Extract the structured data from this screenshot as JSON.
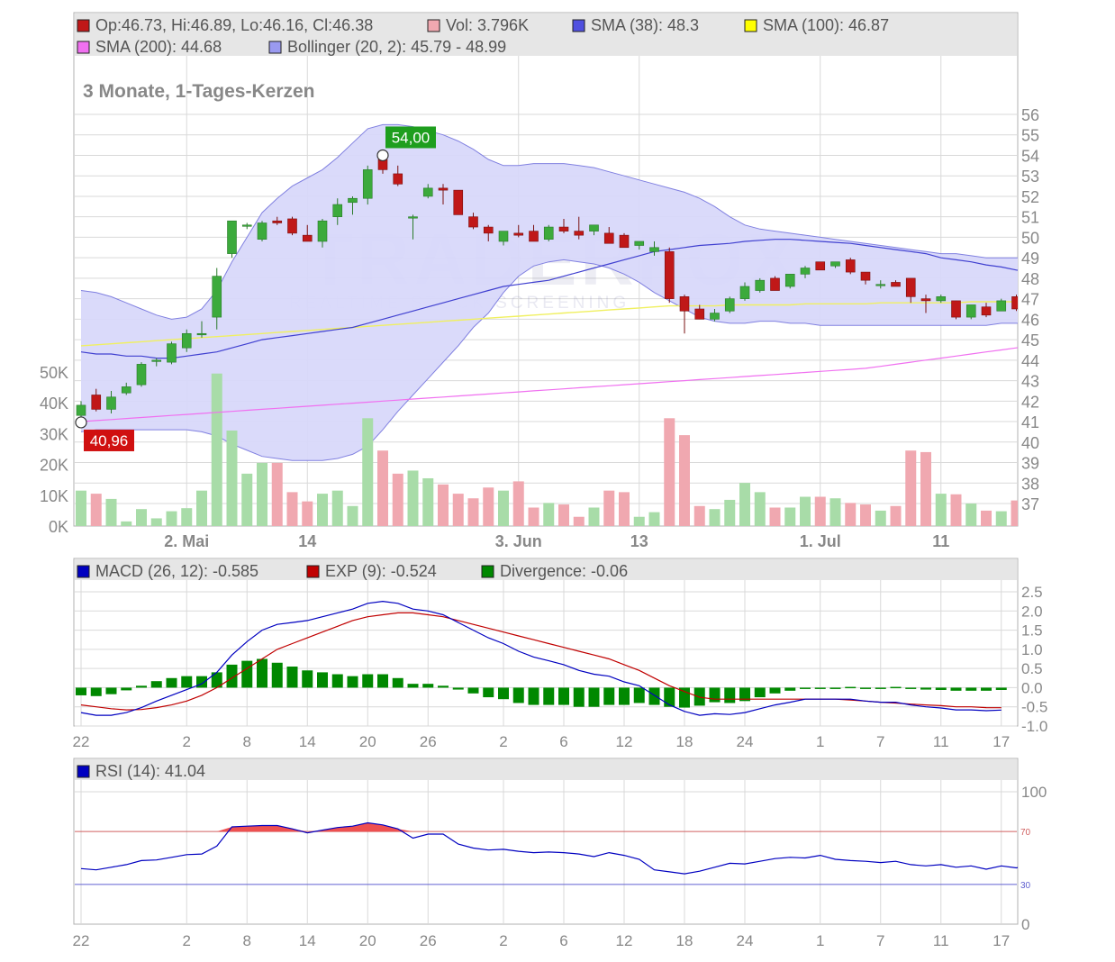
{
  "colors": {
    "up": "#3caa3c",
    "down": "#c01818",
    "up_vol": "#a8dca8",
    "down_vol": "#f0a8b0",
    "band": "#d8d8fa",
    "band_line": "#8080e0",
    "sma38": "#4040d0",
    "sma100": "#f0f060",
    "sma200": "#f070f0",
    "macd": "#0000c0",
    "signal": "#c00000",
    "hist": "#008800",
    "rsi": "#0000c0",
    "grid": "#d9d9d9",
    "legend_bg": "#e6e6e6",
    "axis_text": "#888888"
  },
  "price_panel": {
    "legend_row1": [
      {
        "swatch": "#c01818",
        "text": "Op:46.73, Hi:46.89, Lo:46.16, Cl:46.38"
      },
      {
        "swatch": "#f0a8b0",
        "text": "Vol: 3.796K"
      },
      {
        "swatch": "#5050e0",
        "text": "SMA (38): 48.3"
      },
      {
        "swatch": "#ffff00",
        "text": "SMA (100): 46.87"
      }
    ],
    "legend_row2": [
      {
        "swatch": "#f070f0",
        "text": "SMA (200): 44.68"
      },
      {
        "swatch": "#9a9af0",
        "text": "Bollinger (20, 2): 45.79 - 48.99"
      }
    ],
    "subtitle": "3 Monate, 1-Tages-Kerzen",
    "watermark": "TRADERFOX",
    "watermark_sub": "REALTIME STOCK SCREENING",
    "high_label": "54,00",
    "low_label": "40,96",
    "x_labels": [
      {
        "i": 7,
        "t": "2. Mai"
      },
      {
        "i": 15,
        "t": "14"
      },
      {
        "i": 29,
        "t": "3. Jun"
      },
      {
        "i": 37,
        "t": "13"
      },
      {
        "i": 49,
        "t": "1. Jul"
      },
      {
        "i": 57,
        "t": "11"
      }
    ],
    "y_labels": [
      "56",
      "55",
      "54",
      "53",
      "52",
      "51",
      "50",
      "49",
      "48",
      "47",
      "46",
      "45",
      "44",
      "43",
      "42",
      "41",
      "40",
      "39",
      "38",
      "37"
    ],
    "vol_labels": [
      "50K",
      "40K",
      "30K",
      "20K",
      "10K",
      "0K"
    ]
  },
  "macd_panel": {
    "legend": [
      {
        "swatch": "#0000c0",
        "text": "MACD (26, 12): -0.585"
      },
      {
        "swatch": "#c00000",
        "text": "EXP (9): -0.524"
      },
      {
        "swatch": "#008800",
        "text": "Divergence: -0.06"
      }
    ],
    "y_labels": [
      "2.5",
      "2.0",
      "1.5",
      "1.0",
      "0.5",
      "0.0",
      "-0.5",
      "-1.0"
    ]
  },
  "rsi_panel": {
    "legend": [
      {
        "swatch": "#0000c0",
        "text": "RSI (14): 41.04"
      }
    ],
    "y_labels": [
      "100",
      "0"
    ],
    "level_high": "70",
    "level_low": "30"
  },
  "bottom_x_labels": [
    {
      "i": 0,
      "t": "22"
    },
    {
      "i": 7,
      "t": "2"
    },
    {
      "i": 11,
      "t": "8"
    },
    {
      "i": 15,
      "t": "14"
    },
    {
      "i": 19,
      "t": "20"
    },
    {
      "i": 23,
      "t": "26"
    },
    {
      "i": 28,
      "t": "2"
    },
    {
      "i": 32,
      "t": "6"
    },
    {
      "i": 36,
      "t": "12"
    },
    {
      "i": 40,
      "t": "18"
    },
    {
      "i": 44,
      "t": "24"
    },
    {
      "i": 49,
      "t": "1"
    },
    {
      "i": 53,
      "t": "7"
    },
    {
      "i": 57,
      "t": "11"
    },
    {
      "i": 61,
      "t": "17"
    }
  ],
  "chart_data": {
    "type": "candlestick",
    "title": "3 Monate, 1-Tages-Kerzen",
    "price_range": [
      37,
      56
    ],
    "volume_range": [
      0,
      50000
    ],
    "candles": [
      {
        "o": 41.3,
        "h": 42.0,
        "l": 40.96,
        "c": 41.8,
        "v": 11500
      },
      {
        "o": 42.3,
        "h": 42.6,
        "l": 41.5,
        "c": 41.6,
        "v": 10500
      },
      {
        "o": 41.6,
        "h": 42.5,
        "l": 41.4,
        "c": 42.2,
        "v": 8800
      },
      {
        "o": 42.4,
        "h": 42.9,
        "l": 42.3,
        "c": 42.7,
        "v": 1500
      },
      {
        "o": 42.8,
        "h": 43.9,
        "l": 42.7,
        "c": 43.8,
        "v": 5500
      },
      {
        "o": 44.0,
        "h": 44.1,
        "l": 43.7,
        "c": 44.0,
        "v": 2500
      },
      {
        "o": 43.9,
        "h": 44.9,
        "l": 43.8,
        "c": 44.8,
        "v": 4800
      },
      {
        "o": 44.6,
        "h": 45.5,
        "l": 44.4,
        "c": 45.3,
        "v": 5800
      },
      {
        "o": 45.3,
        "h": 45.9,
        "l": 45.1,
        "c": 45.3,
        "v": 11500
      },
      {
        "o": 46.1,
        "h": 48.5,
        "l": 45.5,
        "c": 48.1,
        "v": 49500
      },
      {
        "o": 49.2,
        "h": 50.8,
        "l": 49.0,
        "c": 50.8,
        "v": 31000
      },
      {
        "o": 50.6,
        "h": 50.7,
        "l": 50.4,
        "c": 50.6,
        "v": 17000
      },
      {
        "o": 49.9,
        "h": 50.8,
        "l": 49.8,
        "c": 50.7,
        "v": 20500
      },
      {
        "o": 50.8,
        "h": 51.0,
        "l": 50.6,
        "c": 50.7,
        "v": 20500
      },
      {
        "o": 50.9,
        "h": 51.0,
        "l": 50.1,
        "c": 50.2,
        "v": 11000
      },
      {
        "o": 50.1,
        "h": 50.6,
        "l": 49.8,
        "c": 49.8,
        "v": 8000
      },
      {
        "o": 49.8,
        "h": 50.9,
        "l": 49.5,
        "c": 50.8,
        "v": 10500
      },
      {
        "o": 51.0,
        "h": 51.9,
        "l": 50.6,
        "c": 51.6,
        "v": 11500
      },
      {
        "o": 51.7,
        "h": 52.0,
        "l": 51.1,
        "c": 51.9,
        "v": 6500
      },
      {
        "o": 51.9,
        "h": 53.5,
        "l": 51.6,
        "c": 53.3,
        "v": 35000
      },
      {
        "o": 53.8,
        "h": 54.0,
        "l": 53.1,
        "c": 53.3,
        "v": 24500
      },
      {
        "o": 53.1,
        "h": 53.5,
        "l": 52.5,
        "c": 52.6,
        "v": 17000
      },
      {
        "o": 51.0,
        "h": 51.1,
        "l": 49.9,
        "c": 51.0,
        "v": 18000
      },
      {
        "o": 52.0,
        "h": 52.6,
        "l": 51.9,
        "c": 52.4,
        "v": 15500
      },
      {
        "o": 52.4,
        "h": 52.6,
        "l": 51.6,
        "c": 52.3,
        "v": 13500
      },
      {
        "o": 52.3,
        "h": 52.3,
        "l": 51.1,
        "c": 51.1,
        "v": 10500
      },
      {
        "o": 51.0,
        "h": 51.2,
        "l": 50.4,
        "c": 50.5,
        "v": 9000
      },
      {
        "o": 50.5,
        "h": 50.6,
        "l": 49.8,
        "c": 50.2,
        "v": 12500
      },
      {
        "o": 49.8,
        "h": 50.3,
        "l": 49.6,
        "c": 50.3,
        "v": 11500
      },
      {
        "o": 50.2,
        "h": 50.6,
        "l": 50.0,
        "c": 50.1,
        "v": 14500
      },
      {
        "o": 50.3,
        "h": 50.6,
        "l": 49.8,
        "c": 49.8,
        "v": 6000
      },
      {
        "o": 49.9,
        "h": 50.6,
        "l": 49.8,
        "c": 50.5,
        "v": 7500
      },
      {
        "o": 50.5,
        "h": 50.9,
        "l": 50.2,
        "c": 50.3,
        "v": 7000
      },
      {
        "o": 50.3,
        "h": 51.0,
        "l": 49.9,
        "c": 50.1,
        "v": 3000
      },
      {
        "o": 50.3,
        "h": 50.6,
        "l": 50.1,
        "c": 50.6,
        "v": 6000
      },
      {
        "o": 50.2,
        "h": 50.5,
        "l": 49.7,
        "c": 49.7,
        "v": 11500
      },
      {
        "o": 50.1,
        "h": 50.2,
        "l": 49.5,
        "c": 49.5,
        "v": 11000
      },
      {
        "o": 49.6,
        "h": 49.8,
        "l": 49.4,
        "c": 49.8,
        "v": 3000
      },
      {
        "o": 49.3,
        "h": 49.8,
        "l": 49.1,
        "c": 49.5,
        "v": 4500
      },
      {
        "o": 49.3,
        "h": 49.5,
        "l": 46.8,
        "c": 47.0,
        "v": 35000
      },
      {
        "o": 47.1,
        "h": 47.2,
        "l": 45.3,
        "c": 46.4,
        "v": 29500
      },
      {
        "o": 46.5,
        "h": 46.7,
        "l": 46.0,
        "c": 46.0,
        "v": 6500
      },
      {
        "o": 46.0,
        "h": 46.5,
        "l": 45.9,
        "c": 46.3,
        "v": 5500
      },
      {
        "o": 46.4,
        "h": 47.1,
        "l": 46.3,
        "c": 47.0,
        "v": 8500
      },
      {
        "o": 47.0,
        "h": 47.8,
        "l": 46.9,
        "c": 47.6,
        "v": 14000
      },
      {
        "o": 47.4,
        "h": 48.0,
        "l": 47.3,
        "c": 47.9,
        "v": 11000
      },
      {
        "o": 48.0,
        "h": 48.1,
        "l": 47.4,
        "c": 47.4,
        "v": 6000
      },
      {
        "o": 47.6,
        "h": 48.2,
        "l": 47.5,
        "c": 48.2,
        "v": 6000
      },
      {
        "o": 48.2,
        "h": 48.6,
        "l": 48.0,
        "c": 48.5,
        "v": 9500
      },
      {
        "o": 48.8,
        "h": 48.8,
        "l": 48.4,
        "c": 48.4,
        "v": 9500
      },
      {
        "o": 48.6,
        "h": 48.8,
        "l": 48.5,
        "c": 48.8,
        "v": 9000
      },
      {
        "o": 48.9,
        "h": 49.0,
        "l": 48.2,
        "c": 48.3,
        "v": 7500
      },
      {
        "o": 48.3,
        "h": 48.3,
        "l": 47.7,
        "c": 47.9,
        "v": 7000
      },
      {
        "o": 47.7,
        "h": 47.9,
        "l": 47.5,
        "c": 47.7,
        "v": 5000
      },
      {
        "o": 47.8,
        "h": 47.9,
        "l": 47.6,
        "c": 47.6,
        "v": 6500
      },
      {
        "o": 48.0,
        "h": 48.0,
        "l": 46.8,
        "c": 47.1,
        "v": 24500
      },
      {
        "o": 47.0,
        "h": 47.2,
        "l": 46.3,
        "c": 46.9,
        "v": 24000
      },
      {
        "o": 46.9,
        "h": 47.2,
        "l": 46.8,
        "c": 47.1,
        "v": 10500
      },
      {
        "o": 46.9,
        "h": 46.9,
        "l": 46.0,
        "c": 46.1,
        "v": 10300
      },
      {
        "o": 46.1,
        "h": 46.7,
        "l": 46.0,
        "c": 46.7,
        "v": 7300
      },
      {
        "o": 46.6,
        "h": 46.8,
        "l": 46.1,
        "c": 46.2,
        "v": 5000
      },
      {
        "o": 46.4,
        "h": 47.0,
        "l": 46.4,
        "c": 46.9,
        "v": 4800
      },
      {
        "o": 47.1,
        "h": 47.2,
        "l": 46.4,
        "c": 46.5,
        "v": 8300
      },
      {
        "o": 46.73,
        "h": 46.89,
        "l": 46.16,
        "c": 46.38,
        "v": 3796
      }
    ],
    "bollinger_upper": [
      47.4,
      47.3,
      47.1,
      46.8,
      46.5,
      46.2,
      46.0,
      46.1,
      46.5,
      47.4,
      48.8,
      50.0,
      51.2,
      51.9,
      52.5,
      52.9,
      53.3,
      53.9,
      54.6,
      55.3,
      55.5,
      55.5,
      55.4,
      55.2,
      55.0,
      54.7,
      54.3,
      53.8,
      53.5,
      53.5,
      53.6,
      53.6,
      53.6,
      53.5,
      53.4,
      53.2,
      53.0,
      52.8,
      52.6,
      52.4,
      52.2,
      51.9,
      51.5,
      51.0,
      50.6,
      50.4,
      50.3,
      50.2,
      50.1,
      50.0,
      49.9,
      49.8,
      49.7,
      49.6,
      49.5,
      49.4,
      49.3,
      49.2,
      49.2,
      49.1,
      49.0,
      49.0,
      49.0,
      48.99
    ],
    "bollinger_lower": [
      40.5,
      40.6,
      40.6,
      40.6,
      40.6,
      40.6,
      40.6,
      40.6,
      40.5,
      40.3,
      39.9,
      39.6,
      39.3,
      39.2,
      39.1,
      39.1,
      39.1,
      39.2,
      39.4,
      39.8,
      40.6,
      41.5,
      42.3,
      43.1,
      43.9,
      44.7,
      45.6,
      46.3,
      47.3,
      48.1,
      48.6,
      48.8,
      48.9,
      48.8,
      48.7,
      48.5,
      48.2,
      47.8,
      47.3,
      46.9,
      46.5,
      46.1,
      45.9,
      45.8,
      45.8,
      45.9,
      45.9,
      45.8,
      45.8,
      45.7,
      45.7,
      45.7,
      45.7,
      45.7,
      45.7,
      45.7,
      45.7,
      45.7,
      45.7,
      45.7,
      45.7,
      45.8,
      45.8,
      45.79
    ],
    "sma38": [
      44.4,
      44.3,
      44.3,
      44.2,
      44.2,
      44.1,
      44.1,
      44.2,
      44.3,
      44.4,
      44.6,
      44.8,
      45.0,
      45.1,
      45.2,
      45.3,
      45.4,
      45.5,
      45.6,
      45.8,
      46.0,
      46.2,
      46.4,
      46.6,
      46.8,
      47.0,
      47.2,
      47.4,
      47.6,
      47.7,
      47.8,
      47.9,
      48.1,
      48.3,
      48.5,
      48.7,
      48.9,
      49.1,
      49.3,
      49.4,
      49.5,
      49.6,
      49.65,
      49.7,
      49.8,
      49.85,
      49.9,
      49.9,
      49.85,
      49.8,
      49.75,
      49.7,
      49.6,
      49.5,
      49.4,
      49.3,
      49.2,
      49.0,
      48.9,
      48.8,
      48.65,
      48.55,
      48.4,
      48.3
    ],
    "sma100": [
      44.7,
      44.75,
      44.8,
      44.85,
      44.9,
      44.95,
      45.0,
      45.05,
      45.1,
      45.15,
      45.2,
      45.25,
      45.3,
      45.35,
      45.4,
      45.45,
      45.5,
      45.55,
      45.6,
      45.65,
      45.7,
      45.75,
      45.8,
      45.85,
      45.9,
      45.95,
      46.0,
      46.05,
      46.1,
      46.15,
      46.2,
      46.25,
      46.3,
      46.35,
      46.4,
      46.45,
      46.5,
      46.55,
      46.6,
      46.65,
      46.65,
      46.65,
      46.65,
      46.7,
      46.7,
      46.7,
      46.7,
      46.7,
      46.75,
      46.75,
      46.75,
      46.75,
      46.75,
      46.8,
      46.8,
      46.8,
      46.8,
      46.8,
      46.8,
      46.85,
      46.85,
      46.85,
      46.85,
      46.87
    ],
    "sma200": [
      41.0,
      41.05,
      41.1,
      41.15,
      41.2,
      41.25,
      41.3,
      41.35,
      41.4,
      41.45,
      41.5,
      41.55,
      41.6,
      41.65,
      41.7,
      41.75,
      41.8,
      41.85,
      41.9,
      41.95,
      42.0,
      42.05,
      42.1,
      42.15,
      42.2,
      42.25,
      42.3,
      42.35,
      42.4,
      42.45,
      42.5,
      42.55,
      42.6,
      42.65,
      42.7,
      42.75,
      42.8,
      42.85,
      42.9,
      42.95,
      43.0,
      43.05,
      43.1,
      43.15,
      43.2,
      43.25,
      43.3,
      43.35,
      43.4,
      43.45,
      43.5,
      43.55,
      43.6,
      43.7,
      43.8,
      43.9,
      44.0,
      44.1,
      44.2,
      44.3,
      44.4,
      44.5,
      44.6,
      44.68
    ],
    "macd_range": [
      -1.0,
      2.5
    ],
    "macd": [
      -0.65,
      -0.72,
      -0.72,
      -0.65,
      -0.52,
      -0.35,
      -0.2,
      -0.05,
      0.1,
      0.4,
      0.85,
      1.2,
      1.5,
      1.65,
      1.7,
      1.75,
      1.85,
      1.95,
      2.05,
      2.2,
      2.25,
      2.2,
      2.05,
      2.0,
      1.9,
      1.7,
      1.5,
      1.3,
      1.15,
      0.95,
      0.8,
      0.7,
      0.6,
      0.45,
      0.35,
      0.3,
      0.15,
      0.05,
      -0.2,
      -0.45,
      -0.62,
      -0.72,
      -0.68,
      -0.7,
      -0.65,
      -0.55,
      -0.45,
      -0.38,
      -0.3,
      -0.3,
      -0.3,
      -0.3,
      -0.35,
      -0.38,
      -0.38,
      -0.45,
      -0.5,
      -0.53,
      -0.58,
      -0.58,
      -0.6,
      -0.585
    ],
    "signal": [
      -0.45,
      -0.5,
      -0.55,
      -0.58,
      -0.57,
      -0.52,
      -0.45,
      -0.35,
      -0.2,
      0.0,
      0.25,
      0.5,
      0.75,
      1.0,
      1.15,
      1.3,
      1.45,
      1.6,
      1.75,
      1.85,
      1.9,
      1.95,
      1.95,
      1.9,
      1.85,
      1.75,
      1.65,
      1.55,
      1.45,
      1.35,
      1.25,
      1.15,
      1.05,
      0.95,
      0.85,
      0.75,
      0.6,
      0.45,
      0.25,
      0.05,
      -0.1,
      -0.25,
      -0.3,
      -0.3,
      -0.3,
      -0.3,
      -0.3,
      -0.3,
      -0.3,
      -0.3,
      -0.3,
      -0.32,
      -0.35,
      -0.38,
      -0.4,
      -0.43,
      -0.45,
      -0.47,
      -0.5,
      -0.5,
      -0.52,
      -0.524
    ],
    "divergence": [
      -0.2,
      -0.22,
      -0.17,
      -0.07,
      0.05,
      0.17,
      0.25,
      0.3,
      0.3,
      0.4,
      0.6,
      0.7,
      0.75,
      0.65,
      0.55,
      0.45,
      0.4,
      0.35,
      0.3,
      0.35,
      0.35,
      0.25,
      0.1,
      0.1,
      0.05,
      -0.05,
      -0.15,
      -0.25,
      -0.3,
      -0.4,
      -0.45,
      -0.45,
      -0.45,
      -0.5,
      -0.5,
      -0.45,
      -0.45,
      -0.4,
      -0.45,
      -0.5,
      -0.52,
      -0.47,
      -0.38,
      -0.4,
      -0.35,
      -0.25,
      -0.15,
      -0.08,
      0.0,
      0.0,
      0.0,
      0.02,
      0.0,
      0.0,
      0.02,
      -0.02,
      -0.05,
      -0.06,
      -0.08,
      -0.08,
      -0.08,
      -0.06
    ],
    "rsi_range": [
      0,
      100
    ],
    "rsi": [
      42,
      41,
      43,
      45,
      48,
      48.5,
      50.5,
      52.5,
      53,
      59,
      73.5,
      74,
      74.5,
      74.5,
      72,
      69,
      71,
      73,
      74,
      76.5,
      75,
      72,
      65,
      68,
      68,
      60.5,
      57.5,
      56,
      56.5,
      55,
      54,
      54.5,
      54,
      53,
      51,
      54,
      52,
      49,
      41,
      39.5,
      38,
      40,
      43,
      46,
      45.5,
      47.5,
      49.5,
      50.5,
      50,
      52,
      49,
      48,
      47.5,
      46.5,
      47.5,
      45,
      44,
      45,
      43,
      44,
      41.5,
      44,
      42.5,
      45.5,
      41.5,
      44.5,
      42,
      41.04
    ]
  }
}
